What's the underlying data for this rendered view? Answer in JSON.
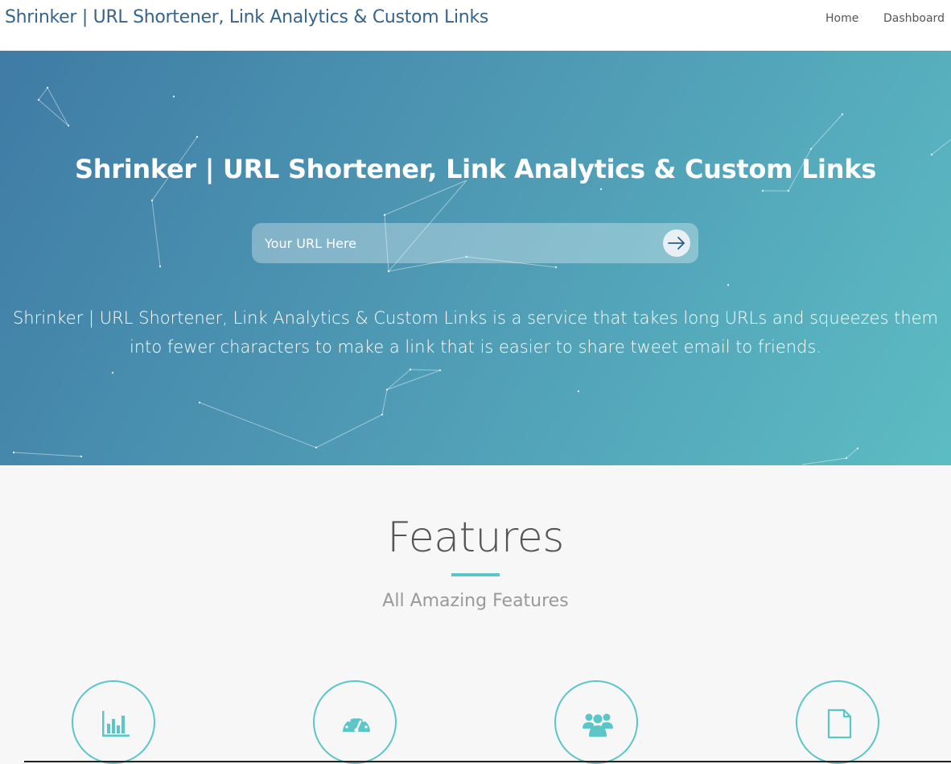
{
  "navbar": {
    "brand": "Shrinker | URL Shortener, Link Analytics & Custom Links",
    "links": [
      {
        "label": "Home"
      },
      {
        "label": "Dashboard"
      }
    ]
  },
  "hero": {
    "title": "Shrinker | URL Shortener, Link Analytics & Custom Links",
    "url_input": {
      "placeholder": "Your URL Here",
      "value": ""
    },
    "submit_icon": "arrow-right-icon",
    "description": "Shrinker | URL Shortener, Link Analytics & Custom Links is a service that takes long URLs and squeezes them into fewer characters to make a link that is easier to share tweet email to friends.",
    "gradient_colors": [
      "#3f7ba5",
      "#5cbcc3"
    ]
  },
  "features": {
    "title": "Features",
    "subtitle": "All Amazing Features",
    "accent_color": "#5bc6c8",
    "items": [
      {
        "icon": "bar-chart-icon"
      },
      {
        "icon": "speedometer-icon"
      },
      {
        "icon": "users-icon"
      },
      {
        "icon": "file-icon"
      }
    ]
  }
}
